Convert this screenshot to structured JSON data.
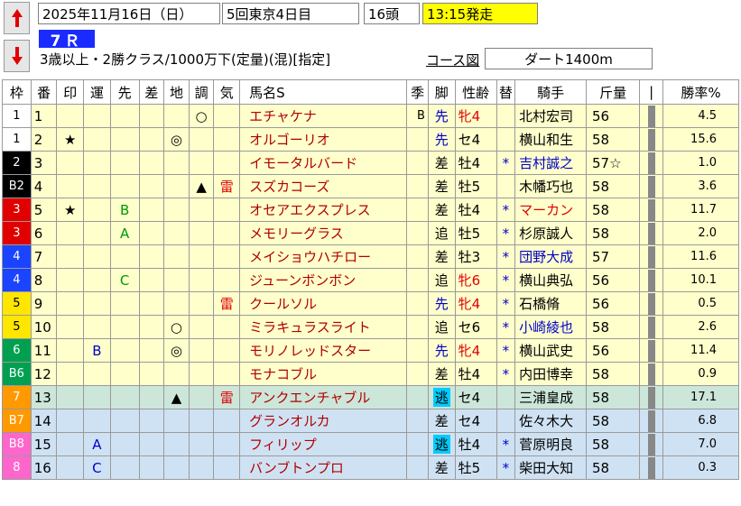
{
  "header": {
    "date": "2025年11月16日（日）",
    "meeting": "5回東京4日目",
    "heads": "16頭",
    "start_time": "13:15発走",
    "race_no": "7Ｒ",
    "condition": "3歳以上・2勝クラス/1000万下(定量)(混)[指定]",
    "course_link": "コース図",
    "course": "ダート1400m"
  },
  "colors": {
    "name_text": "#b00000",
    "blue_text": "#0000cc",
    "red_text": "#e00000",
    "green_text": "#009900",
    "race_badge": "#1a2bff",
    "start_bg": "#ffff00",
    "nige_bg": "#00ccff",
    "row_yellow": "#ffffcc",
    "row_green": "#cce6d9",
    "row_blue": "#cfe2f3"
  },
  "columns": [
    "枠",
    "番",
    "印",
    "運",
    "先",
    "差",
    "地",
    "調",
    "気",
    "馬名S",
    "季",
    "脚",
    "性齢",
    "替",
    "騎手",
    "斤量",
    "|",
    "勝率%"
  ],
  "rows": [
    {
      "waku": "1",
      "num": "1",
      "in": "",
      "un": "",
      "saki": "",
      "sa": "",
      "chi": "",
      "cho": "○",
      "ki": "",
      "name": "エチャケナ",
      "kisetsu": "B",
      "ashi": "先",
      "sex": "牝4",
      "kae": "",
      "jockey": "北村宏司",
      "kin": "56",
      "odds": "4.5",
      "wbg": "#ffffff",
      "wfg": "#000000",
      "ashiColor": "#0000cc",
      "sexColor": "#e00000",
      "jockeyColor": "#000000",
      "bg": "bg-y"
    },
    {
      "waku": "1",
      "num": "2",
      "in": "★",
      "un": "",
      "saki": "",
      "sa": "",
      "chi": "◎",
      "cho": "",
      "ki": "",
      "name": "オルゴーリオ",
      "kisetsu": "",
      "ashi": "先",
      "sex": "セ4",
      "kae": "",
      "jockey": "横山和生",
      "kin": "58",
      "odds": "15.6",
      "wbg": "#ffffff",
      "wfg": "#000000",
      "ashiColor": "#0000cc",
      "sexColor": "#000000",
      "jockeyColor": "#000000",
      "bg": "bg-y"
    },
    {
      "waku": "2",
      "num": "3",
      "in": "",
      "un": "",
      "saki": "",
      "sa": "",
      "chi": "",
      "cho": "",
      "ki": "",
      "name": "イモータルバード",
      "kisetsu": "",
      "ashi": "差",
      "sex": "牡4",
      "kae": "*",
      "jockey": "吉村誠之",
      "kin": "57☆",
      "odds": "1.0",
      "wbg": "#000000",
      "wfg": "#ffffff",
      "ashiColor": "#000000",
      "sexColor": "#000000",
      "jockeyColor": "#0000cc",
      "bg": "bg-y"
    },
    {
      "waku": "B2",
      "num": "4",
      "in": "",
      "un": "",
      "saki": "",
      "sa": "",
      "chi": "",
      "cho": "▲",
      "ki": "雷",
      "name": "スズカコーズ",
      "kisetsu": "",
      "ashi": "差",
      "sex": "牡5",
      "kae": "",
      "jockey": "木幡巧也",
      "kin": "58",
      "odds": "3.6",
      "wbg": "#000000",
      "wfg": "#ffffff",
      "ashiColor": "#000000",
      "sexColor": "#000000",
      "jockeyColor": "#000000",
      "bg": "bg-y"
    },
    {
      "waku": "3",
      "num": "5",
      "in": "★",
      "un": "",
      "saki": "B",
      "sa": "",
      "chi": "",
      "cho": "",
      "ki": "",
      "name": "オセアエクスプレス",
      "kisetsu": "",
      "ashi": "差",
      "sex": "牡4",
      "kae": "*",
      "jockey": "マーカン",
      "kin": "58",
      "odds": "11.7",
      "wbg": "#e00000",
      "wfg": "#ffffff",
      "ashiColor": "#000000",
      "sexColor": "#000000",
      "jockeyColor": "#e00000",
      "bg": "bg-y"
    },
    {
      "waku": "3",
      "num": "6",
      "in": "",
      "un": "",
      "saki": "A",
      "sa": "",
      "chi": "",
      "cho": "",
      "ki": "",
      "name": "メモリーグラス",
      "kisetsu": "",
      "ashi": "追",
      "sex": "牡5",
      "kae": "*",
      "jockey": "杉原誠人",
      "kin": "58",
      "odds": "2.0",
      "wbg": "#e00000",
      "wfg": "#ffffff",
      "ashiColor": "#000000",
      "sexColor": "#000000",
      "jockeyColor": "#000000",
      "bg": "bg-y"
    },
    {
      "waku": "4",
      "num": "7",
      "in": "",
      "un": "",
      "saki": "",
      "sa": "",
      "chi": "",
      "cho": "",
      "ki": "",
      "name": "メイショウハチロー",
      "kisetsu": "",
      "ashi": "差",
      "sex": "牡3",
      "kae": "*",
      "jockey": "団野大成",
      "kin": "57",
      "odds": "11.6",
      "wbg": "#1a44ff",
      "wfg": "#ffffff",
      "ashiColor": "#000000",
      "sexColor": "#000000",
      "jockeyColor": "#0000cc",
      "bg": "bg-y"
    },
    {
      "waku": "4",
      "num": "8",
      "in": "",
      "un": "",
      "saki": "C",
      "sa": "",
      "chi": "",
      "cho": "",
      "ki": "",
      "name": "ジューンボンボン",
      "kisetsu": "",
      "ashi": "追",
      "sex": "牝6",
      "kae": "*",
      "jockey": "横山典弘",
      "kin": "56",
      "odds": "10.1",
      "wbg": "#1a44ff",
      "wfg": "#ffffff",
      "ashiColor": "#000000",
      "sexColor": "#e00000",
      "jockeyColor": "#000000",
      "bg": "bg-y"
    },
    {
      "waku": "5",
      "num": "9",
      "in": "",
      "un": "",
      "saki": "",
      "sa": "",
      "chi": "",
      "cho": "",
      "ki": "雷",
      "name": "クールソル",
      "kisetsu": "",
      "ashi": "先",
      "sex": "牝4",
      "kae": "*",
      "jockey": "石橋脩",
      "kin": "56",
      "odds": "0.5",
      "wbg": "#ffe600",
      "wfg": "#000000",
      "ashiColor": "#0000cc",
      "sexColor": "#e00000",
      "jockeyColor": "#000000",
      "bg": "bg-y"
    },
    {
      "waku": "5",
      "num": "10",
      "in": "",
      "un": "",
      "saki": "",
      "sa": "",
      "chi": "○",
      "cho": "",
      "ki": "",
      "name": "ミラキュラスライト",
      "kisetsu": "",
      "ashi": "追",
      "sex": "セ6",
      "kae": "*",
      "jockey": "小崎綾也",
      "kin": "58",
      "odds": "2.6",
      "wbg": "#ffe600",
      "wfg": "#000000",
      "ashiColor": "#000000",
      "sexColor": "#000000",
      "jockeyColor": "#0000cc",
      "bg": "bg-y"
    },
    {
      "waku": "6",
      "num": "11",
      "in": "",
      "un": "B",
      "saki": "",
      "sa": "",
      "chi": "◎",
      "cho": "",
      "ki": "",
      "name": "モリノレッドスター",
      "kisetsu": "",
      "ashi": "先",
      "sex": "牝4",
      "kae": "*",
      "jockey": "横山武史",
      "kin": "56",
      "odds": "11.4",
      "wbg": "#00a050",
      "wfg": "#ffffff",
      "ashiColor": "#0000cc",
      "sexColor": "#e00000",
      "jockeyColor": "#000000",
      "bg": "bg-y"
    },
    {
      "waku": "B6",
      "num": "12",
      "in": "",
      "un": "",
      "saki": "",
      "sa": "",
      "chi": "",
      "cho": "",
      "ki": "",
      "name": "モナコブル",
      "kisetsu": "",
      "ashi": "差",
      "sex": "牡4",
      "kae": "*",
      "jockey": "内田博幸",
      "kin": "58",
      "odds": "0.9",
      "wbg": "#00a050",
      "wfg": "#ffffff",
      "ashiColor": "#000000",
      "sexColor": "#000000",
      "jockeyColor": "#000000",
      "bg": "bg-y"
    },
    {
      "waku": "7",
      "num": "13",
      "in": "",
      "un": "",
      "saki": "",
      "sa": "",
      "chi": "▲",
      "cho": "",
      "ki": "雷",
      "name": "アンクエンチャブル",
      "kisetsu": "",
      "ashi": "逃",
      "sex": "セ4",
      "kae": "",
      "jockey": "三浦皇成",
      "kin": "58",
      "odds": "17.1",
      "wbg": "#ff9900",
      "wfg": "#ffffff",
      "ashiColor": "#000000",
      "sexColor": "#000000",
      "jockeyColor": "#000000",
      "bg": "bg-g",
      "nige": true
    },
    {
      "waku": "B7",
      "num": "14",
      "in": "",
      "un": "",
      "saki": "",
      "sa": "",
      "chi": "",
      "cho": "",
      "ki": "",
      "name": "グランオルカ",
      "kisetsu": "",
      "ashi": "差",
      "sex": "セ4",
      "kae": "",
      "jockey": "佐々木大",
      "kin": "58",
      "odds": "6.8",
      "wbg": "#ff9900",
      "wfg": "#ffffff",
      "ashiColor": "#000000",
      "sexColor": "#000000",
      "jockeyColor": "#000000",
      "bg": "bg-b"
    },
    {
      "waku": "B8",
      "num": "15",
      "in": "",
      "un": "A",
      "saki": "",
      "sa": "",
      "chi": "",
      "cho": "",
      "ki": "",
      "name": "フィリップ",
      "kisetsu": "",
      "ashi": "逃",
      "sex": "牡4",
      "kae": "*",
      "jockey": "菅原明良",
      "kin": "58",
      "odds": "7.0",
      "wbg": "#ff66cc",
      "wfg": "#ffffff",
      "ashiColor": "#000000",
      "sexColor": "#000000",
      "jockeyColor": "#000000",
      "bg": "bg-b",
      "nige": true
    },
    {
      "waku": "8",
      "num": "16",
      "in": "",
      "un": "C",
      "saki": "",
      "sa": "",
      "chi": "",
      "cho": "",
      "ki": "",
      "name": "バンブトンプロ",
      "kisetsu": "",
      "ashi": "差",
      "sex": "牡5",
      "kae": "*",
      "jockey": "柴田大知",
      "kin": "58",
      "odds": "0.3",
      "wbg": "#ff66cc",
      "wfg": "#ffffff",
      "ashiColor": "#000000",
      "sexColor": "#000000",
      "jockeyColor": "#000000",
      "bg": "bg-b"
    }
  ]
}
